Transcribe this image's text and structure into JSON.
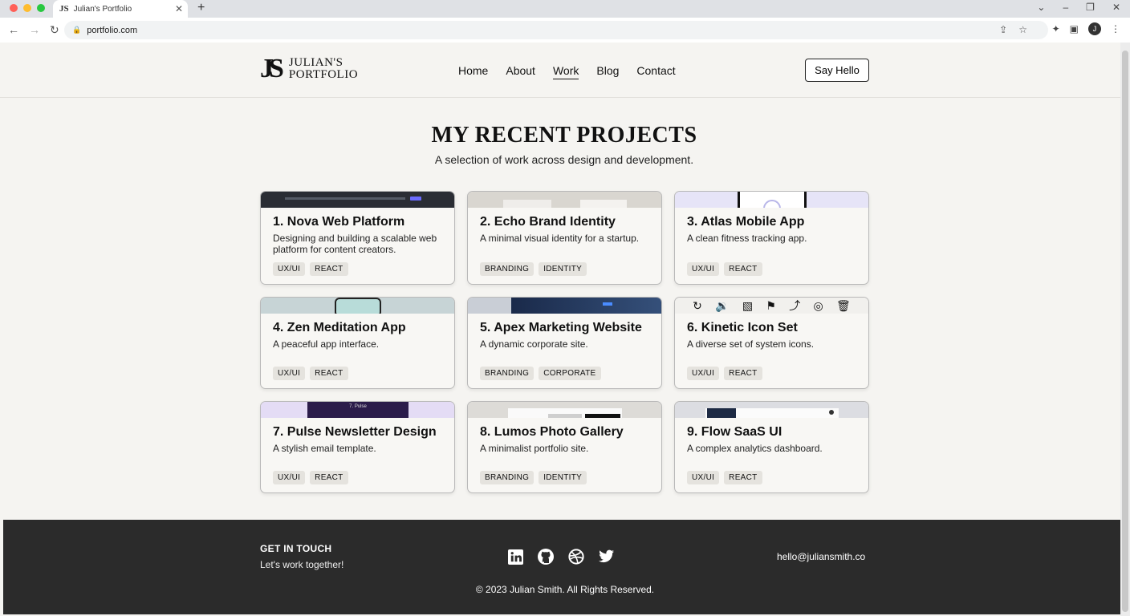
{
  "browser": {
    "tab_title": "Julian's Portfolio",
    "tab_favicon": "JS",
    "url": "portfolio.com",
    "colors": {
      "close": "#ff5f57",
      "minimize": "#febc2e",
      "maximize": "#28c840"
    }
  },
  "header": {
    "logo_mark": "JS",
    "logo_line1": "JULIAN'S",
    "logo_line2": "PORTFOLIO",
    "nav": [
      "Home",
      "About",
      "Work",
      "Blog",
      "Contact"
    ],
    "active_nav": "Work",
    "cta": "Say Hello"
  },
  "hero": {
    "title": "MY RECENT PROJECTS",
    "subtitle": "A selection of work across design and development."
  },
  "projects": [
    {
      "title": "1. Nova Web Platform",
      "desc": "Designing and building a scalable web platform for content creators.",
      "tags": [
        "UX/UI",
        "REACT"
      ]
    },
    {
      "title": "2. Echo Brand Identity",
      "desc": "A minimal visual identity for a startup.",
      "tags": [
        "BRANDING",
        "IDENTITY"
      ]
    },
    {
      "title": "3. Atlas Mobile App",
      "desc": "A clean fitness tracking app.",
      "tags": [
        "UX/UI",
        "REACT"
      ]
    },
    {
      "title": "4. Zen Meditation App",
      "desc": "A peaceful app interface.",
      "tags": [
        "UX/UI",
        "REACT"
      ]
    },
    {
      "title": "5. Apex Marketing Website",
      "desc": "A dynamic corporate site.",
      "tags": [
        "BRANDING",
        "CORPORATE"
      ]
    },
    {
      "title": "6. Kinetic Icon Set",
      "desc": "A diverse set of system icons.",
      "tags": [
        "UX/UI",
        "REACT"
      ]
    },
    {
      "title": "7. Pulse Newsletter Design",
      "desc": "A stylish email template.",
      "tags": [
        "UX/UI",
        "REACT"
      ]
    },
    {
      "title": "8. Lumos Photo Gallery",
      "desc": "A minimalist portfolio site.",
      "tags": [
        "BRANDING",
        "IDENTITY"
      ]
    },
    {
      "title": "9. Flow SaaS UI",
      "desc": "A complex analytics dashboard.",
      "tags": [
        "UX/UI",
        "REACT"
      ]
    }
  ],
  "thumb_text": {
    "pulse": "7. Pulse"
  },
  "footer": {
    "heading": "GET IN TOUCH",
    "sub": "Let's work together!",
    "socials": [
      "linkedin-icon",
      "github-icon",
      "dribbble-icon",
      "twitter-icon"
    ],
    "email": "hello@juliansmith.co",
    "copyright": "© 2023 Julian Smith. All Rights Reserved."
  }
}
